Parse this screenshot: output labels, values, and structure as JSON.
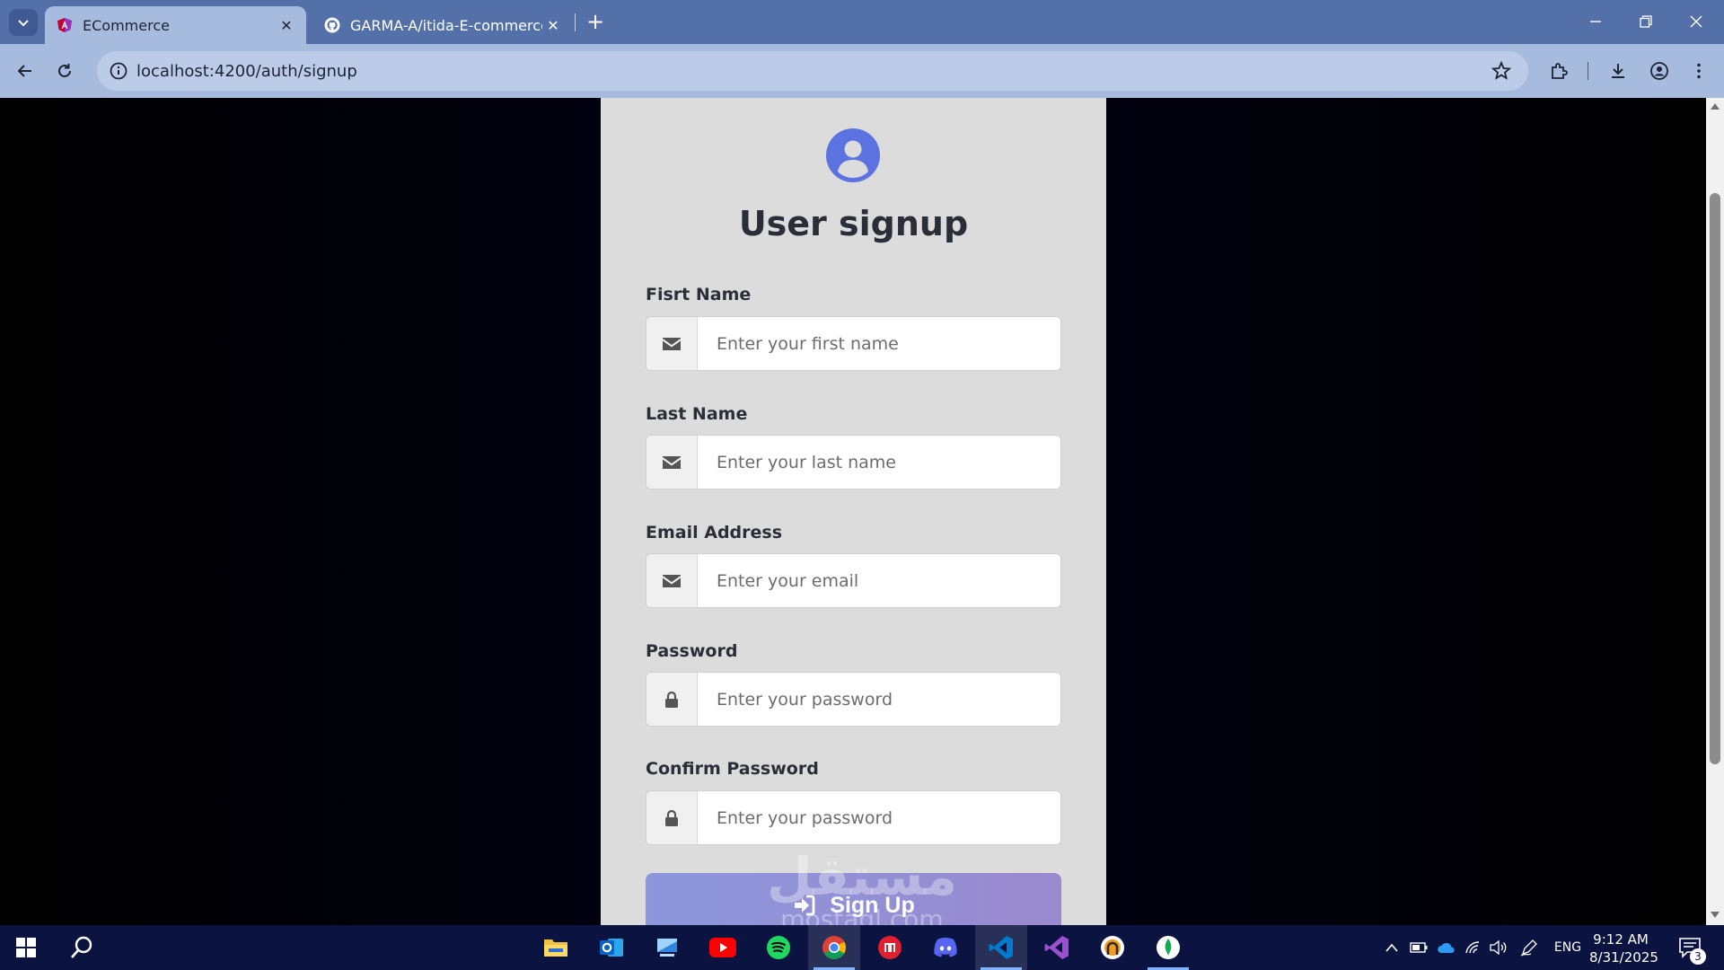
{
  "browser": {
    "tabs": [
      {
        "title": "ECommerce",
        "active": true,
        "icon": "angular-icon"
      },
      {
        "title": "GARMA-A/itida-E-commerce:",
        "active": false,
        "icon": "github-icon"
      }
    ],
    "url": "localhost:4200/auth/signup"
  },
  "form": {
    "title": "User signup",
    "fields": [
      {
        "label": "Fisrt Name",
        "placeholder": "Enter your first name",
        "icon": "envelope-icon"
      },
      {
        "label": "Last Name",
        "placeholder": "Enter your last name",
        "icon": "envelope-icon"
      },
      {
        "label": "Email Address",
        "placeholder": "Enter your email",
        "icon": "envelope-icon"
      },
      {
        "label": "Password",
        "placeholder": "Enter your password",
        "icon": "lock-icon"
      },
      {
        "label": "Confirm Password",
        "placeholder": "Enter your password",
        "icon": "lock-icon"
      }
    ],
    "submit_label": "Sign Up",
    "submit_icon": "sign-in-icon"
  },
  "watermark": {
    "top": "مستقل",
    "bottom": "mostaql.com"
  },
  "taskbar": {
    "apps": [
      "file-explorer-icon",
      "outlook-icon",
      "remote-desktop-icon",
      "youtube-icon",
      "spotify-icon",
      "chrome-icon",
      "app-red-icon",
      "discord-icon",
      "vscode-icon",
      "visual-studio-icon",
      "github-desktop-icon",
      "mongodb-icon"
    ],
    "language": "ENG",
    "time": "9:12 AM",
    "date": "8/31/2025",
    "notifications": "3"
  },
  "colors": {
    "tabbar": "#5470a8",
    "toolbar": "#a7bbdf",
    "card": "#dcdcdc",
    "avatar": "#5b72e0",
    "button_start": "#8d97db",
    "button_end": "#9a89cf",
    "taskbar": "#0b1440"
  }
}
